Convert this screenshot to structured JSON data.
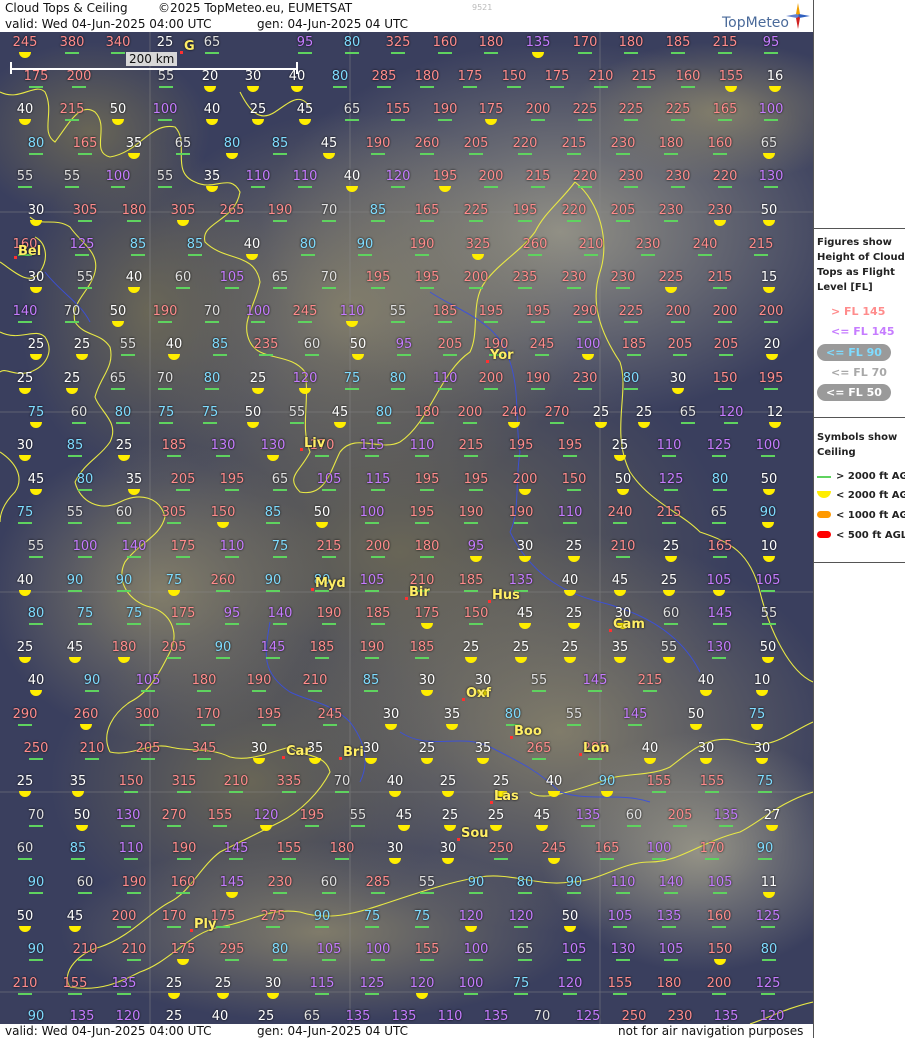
{
  "header": {
    "title": "Cloud Tops & Ceiling",
    "copyright": "©2025 TopMeteo.eu, EUMETSAT",
    "code": "9521",
    "valid": "valid:  Wed  04-Jun-2025  04:00 UTC",
    "generated": "gen: 04-Jun-2025 04 UTC",
    "logo": "TopMeteo"
  },
  "footer": {
    "valid": "valid:  Wed  04-Jun-2025  04:00 UTC",
    "generated": "gen: 04-Jun-2025 04 UTC",
    "disclaimer": "not for air navigation purposes"
  },
  "scale": {
    "label": "200 km"
  },
  "legend": {
    "heading1": [
      "Figures show",
      "Height of Cloud",
      "Tops as Flight",
      "Level  [FL]"
    ],
    "levels": [
      {
        "label": "> FL 145",
        "color": "#ff8c8c",
        "style": "text"
      },
      {
        "label": "<= FL 145",
        "color": "#c67cff",
        "style": "text"
      },
      {
        "label": "<= FL 90",
        "color": "#7fdcff",
        "style": "pill"
      },
      {
        "label": "<= FL 70",
        "color": "#e0e0e0",
        "style": "text-grey"
      },
      {
        "label": "<= FL 50",
        "color": "#ffffff",
        "style": "pill"
      }
    ],
    "heading2": [
      "Symbols show",
      "Ceiling"
    ],
    "symbols": [
      {
        "label": "> 2000 ft AGL",
        "kind": "line",
        "color": "#5fd35f"
      },
      {
        "label": "< 2000 ft AGL",
        "kind": "cap",
        "color": "#ffee00"
      },
      {
        "label": "< 1000 ft AGL",
        "kind": "cap",
        "color": "#ff9900"
      },
      {
        "label": "< 500 ft AGL",
        "kind": "cap",
        "color": "#ff0000"
      }
    ]
  },
  "cities": [
    "Bel",
    "Yor",
    "Liv",
    "Myd",
    "Bir",
    "Hus",
    "Cam",
    "Oxf",
    "Boo",
    "Car",
    "Bri",
    "Lon",
    "Las",
    "Sou",
    "Ply",
    "G"
  ],
  "rows": [
    [
      "245",
      "380",
      "340",
      "25",
      "65",
      "",
      "95",
      "80",
      "325",
      "160",
      "180",
      "135",
      "170",
      "180",
      "185",
      "215",
      "95"
    ],
    [
      "175",
      "200",
      "",
      "55",
      "20",
      "30",
      "40",
      "80",
      "285",
      "180",
      "175",
      "150",
      "175",
      "210",
      "215",
      "160",
      "155",
      "16"
    ],
    [
      "40",
      "215",
      "50",
      "100",
      "40",
      "25",
      "45",
      "65",
      "155",
      "190",
      "175",
      "200",
      "225",
      "225",
      "225",
      "165",
      "100"
    ],
    [
      "80",
      "165",
      "35",
      "65",
      "80",
      "85",
      "45",
      "190",
      "260",
      "205",
      "220",
      "215",
      "230",
      "180",
      "160",
      "65"
    ],
    [
      "55",
      "55",
      "100",
      "55",
      "35",
      "110",
      "110",
      "40",
      "120",
      "195",
      "200",
      "215",
      "220",
      "230",
      "230",
      "220",
      "130"
    ],
    [
      "30",
      "305",
      "180",
      "305",
      "265",
      "190",
      "70",
      "85",
      "165",
      "225",
      "195",
      "220",
      "205",
      "230",
      "230",
      "50"
    ],
    [
      "160",
      "125",
      "85",
      "85",
      "40",
      "80",
      "90",
      "190",
      "325",
      "260",
      "210",
      "230",
      "240",
      "215"
    ],
    [
      "30",
      "55",
      "40",
      "60",
      "105",
      "65",
      "70",
      "195",
      "195",
      "200",
      "235",
      "230",
      "230",
      "225",
      "215",
      "15"
    ],
    [
      "140",
      "70",
      "50",
      "190",
      "70",
      "100",
      "245",
      "110",
      "55",
      "185",
      "195",
      "195",
      "290",
      "225",
      "200",
      "200",
      "200"
    ],
    [
      "25",
      "25",
      "55",
      "40",
      "85",
      "235",
      "60",
      "50",
      "95",
      "205",
      "190",
      "245",
      "100",
      "185",
      "205",
      "205",
      "20"
    ],
    [
      "25",
      "25",
      "65",
      "70",
      "80",
      "25",
      "120",
      "75",
      "80",
      "110",
      "200",
      "190",
      "230",
      "80",
      "30",
      "150",
      "195"
    ],
    [
      "75",
      "60",
      "80",
      "75",
      "75",
      "50",
      "55",
      "45",
      "80",
      "180",
      "200",
      "240",
      "270",
      "25",
      "25",
      "65",
      "120",
      "12"
    ],
    [
      "30",
      "85",
      "25",
      "185",
      "130",
      "130",
      "170",
      "115",
      "110",
      "215",
      "195",
      "195",
      "25",
      "110",
      "125",
      "100"
    ],
    [
      "45",
      "80",
      "35",
      "205",
      "195",
      "65",
      "105",
      "115",
      "195",
      "195",
      "200",
      "150",
      "50",
      "125",
      "80",
      "50"
    ],
    [
      "75",
      "55",
      "60",
      "305",
      "150",
      "85",
      "50",
      "100",
      "195",
      "190",
      "190",
      "110",
      "240",
      "215",
      "65",
      "90"
    ],
    [
      "55",
      "100",
      "140",
      "175",
      "110",
      "75",
      "215",
      "200",
      "180",
      "95",
      "30",
      "25",
      "210",
      "25",
      "165",
      "10"
    ],
    [
      "40",
      "90",
      "90",
      "75",
      "260",
      "90",
      "80",
      "105",
      "210",
      "185",
      "135",
      "40",
      "45",
      "25",
      "105",
      "105"
    ],
    [
      "80",
      "75",
      "75",
      "175",
      "95",
      "140",
      "190",
      "185",
      "175",
      "150",
      "45",
      "25",
      "30",
      "60",
      "145",
      "55"
    ],
    [
      "25",
      "45",
      "180",
      "205",
      "90",
      "145",
      "185",
      "190",
      "185",
      "25",
      "25",
      "25",
      "35",
      "55",
      "130",
      "50"
    ],
    [
      "40",
      "90",
      "105",
      "180",
      "190",
      "210",
      "85",
      "30",
      "30",
      "55",
      "145",
      "215",
      "40",
      "10"
    ],
    [
      "290",
      "260",
      "300",
      "170",
      "195",
      "245",
      "30",
      "35",
      "80",
      "55",
      "145",
      "50",
      "75"
    ],
    [
      "250",
      "210",
      "205",
      "345",
      "30",
      "35",
      "30",
      "25",
      "35",
      "265",
      "285",
      "40",
      "30",
      "30"
    ],
    [
      "25",
      "35",
      "150",
      "315",
      "210",
      "335",
      "70",
      "40",
      "25",
      "25",
      "40",
      "90",
      "155",
      "155",
      "75"
    ],
    [
      "70",
      "50",
      "130",
      "270",
      "155",
      "120",
      "195",
      "55",
      "45",
      "25",
      "25",
      "45",
      "135",
      "60",
      "205",
      "135",
      "27"
    ],
    [
      "60",
      "85",
      "110",
      "190",
      "145",
      "155",
      "180",
      "30",
      "30",
      "250",
      "245",
      "165",
      "100",
      "170",
      "90"
    ],
    [
      "90",
      "60",
      "190",
      "160",
      "145",
      "230",
      "60",
      "285",
      "55",
      "90",
      "80",
      "90",
      "110",
      "140",
      "105",
      "11"
    ],
    [
      "50",
      "45",
      "200",
      "170",
      "175",
      "275",
      "90",
      "75",
      "75",
      "120",
      "120",
      "50",
      "105",
      "135",
      "160",
      "125"
    ],
    [
      "90",
      "210",
      "210",
      "175",
      "295",
      "80",
      "105",
      "100",
      "155",
      "100",
      "65",
      "105",
      "130",
      "105",
      "150",
      "80"
    ],
    [
      "210",
      "155",
      "135",
      "25",
      "25",
      "30",
      "115",
      "125",
      "120",
      "100",
      "75",
      "120",
      "155",
      "180",
      "200",
      "125"
    ],
    [
      "90",
      "135",
      "120",
      "25",
      "40",
      "25",
      "65",
      "135",
      "135",
      "110",
      "135",
      "70",
      "125",
      "250",
      "230",
      "135",
      "120"
    ]
  ]
}
